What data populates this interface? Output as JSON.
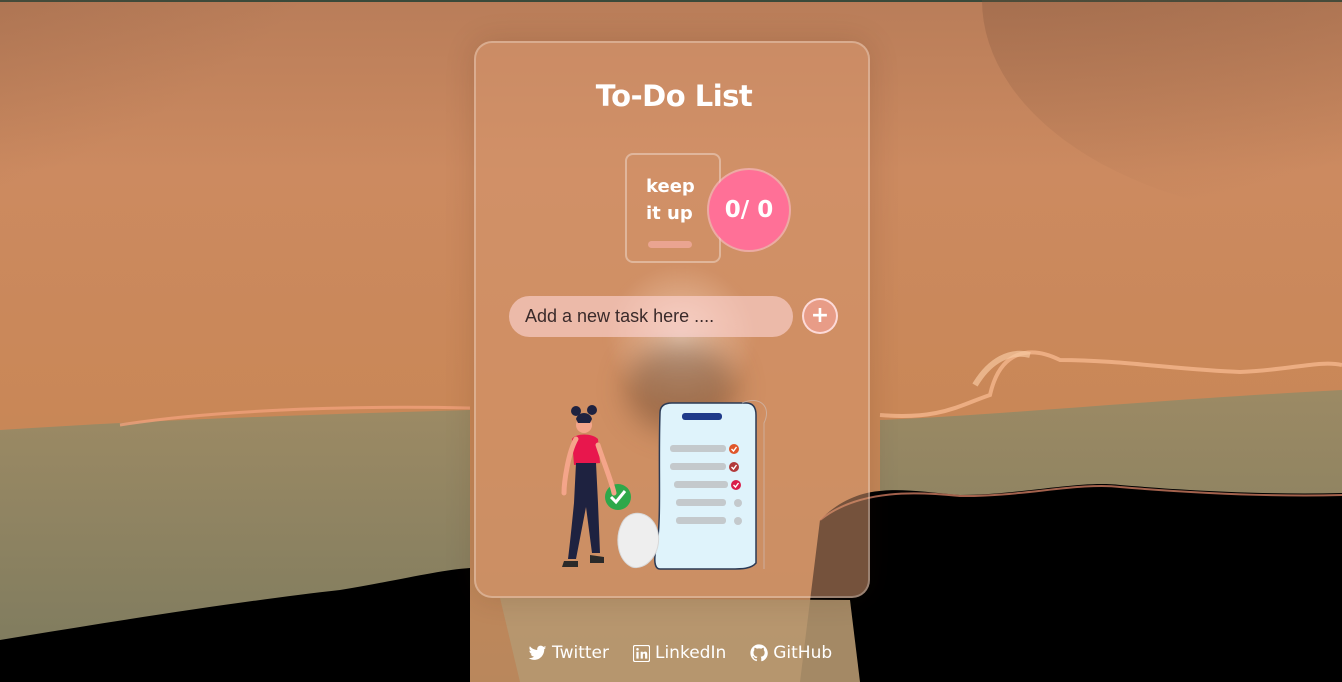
{
  "app": {
    "title": "To-Do List"
  },
  "stats": {
    "message_line1": "keep",
    "message_line2": "it up",
    "counter": "0/ 0",
    "completed": 0,
    "total": 0,
    "progress_fraction": 0
  },
  "task_input": {
    "placeholder": "Add a new task here ....",
    "value": ""
  },
  "add_button": {
    "label": "+"
  },
  "footer": {
    "links": [
      {
        "label": "Twitter",
        "icon": "twitter-icon"
      },
      {
        "label": "LinkedIn",
        "icon": "linkedin-icon"
      },
      {
        "label": "GitHub",
        "icon": "github-icon"
      }
    ]
  },
  "colors": {
    "accent": "#ff7097",
    "title_text": "#ffffff",
    "sky": "#c98a62",
    "ground": "#000000"
  }
}
